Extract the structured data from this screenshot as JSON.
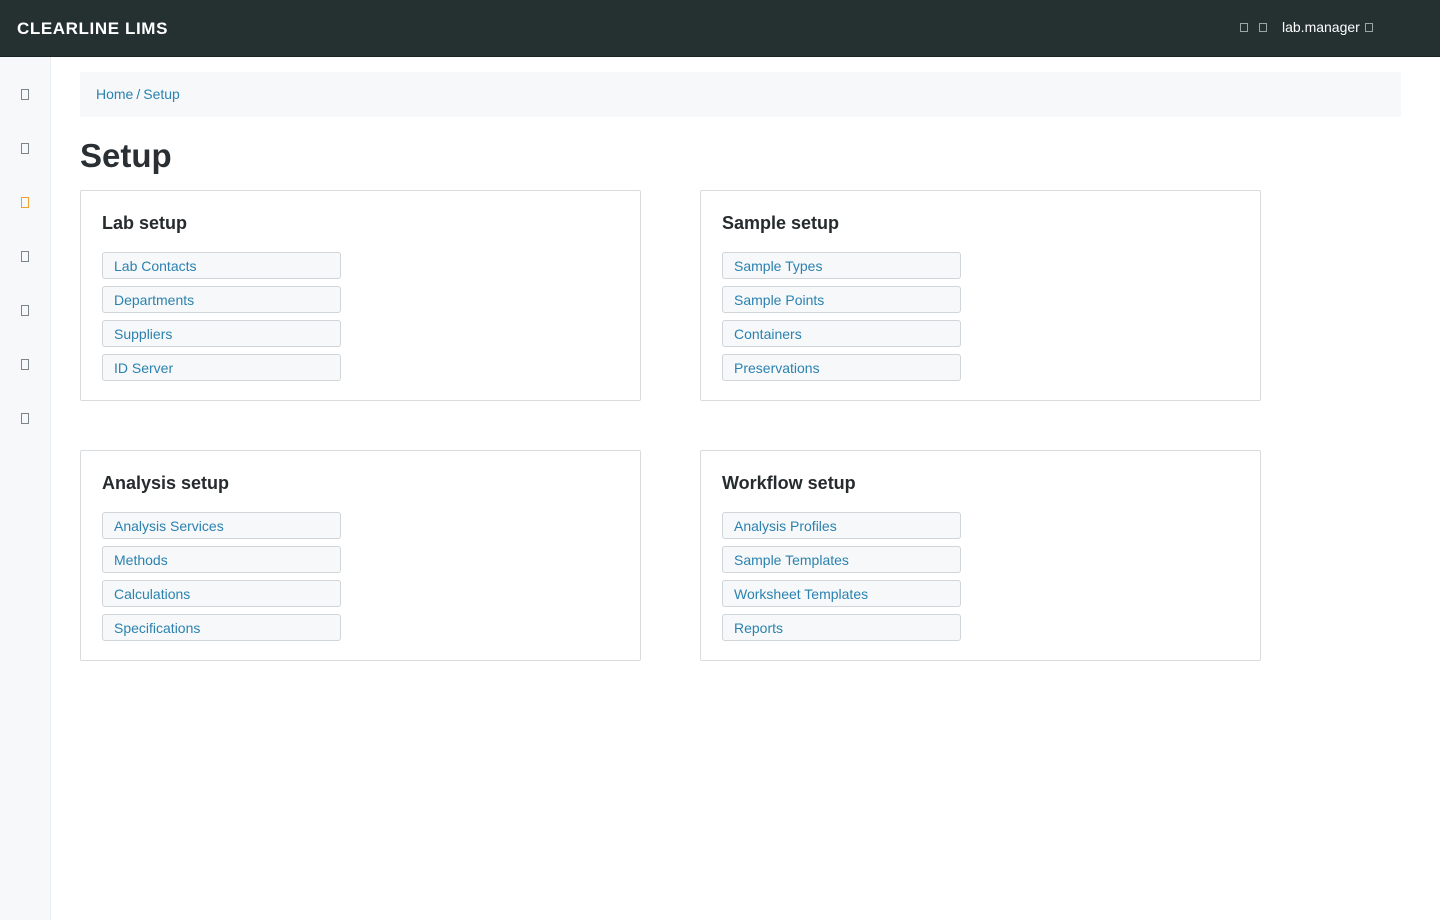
{
  "app": {
    "brand": "CLEARLINE LIMS"
  },
  "topbar": {
    "icons": [
      "notifications-icon",
      "help-icon"
    ],
    "user": "lab.manager",
    "user_icon": "chevron-down-icon"
  },
  "sidebar": {
    "items": [
      {
        "icon": "home-icon",
        "active": false
      },
      {
        "icon": "samples-icon",
        "active": false
      },
      {
        "icon": "setup-icon",
        "active": true
      },
      {
        "icon": "worksheets-icon",
        "active": false
      },
      {
        "icon": "clients-icon",
        "active": false
      },
      {
        "icon": "reports-icon",
        "active": false
      },
      {
        "icon": "settings-icon",
        "active": false
      }
    ],
    "active_color": "#f0a030"
  },
  "breadcrumb": {
    "home": "Home",
    "separator": "/",
    "current": "Setup"
  },
  "page": {
    "title": "Setup"
  },
  "panels": [
    {
      "title": "Lab setup",
      "links": [
        "Lab Contacts",
        "Departments",
        "Suppliers",
        "ID Server"
      ]
    },
    {
      "title": "Sample setup",
      "links": [
        "Sample Types",
        "Sample Points",
        "Containers",
        "Preservations"
      ]
    },
    {
      "title": "Analysis setup",
      "links": [
        "Analysis Services",
        "Methods",
        "Calculations",
        "Specifications"
      ]
    },
    {
      "title": "Workflow setup",
      "links": [
        "Analysis Profiles",
        "Sample Templates",
        "Worksheet Templates",
        "Reports"
      ]
    }
  ],
  "colors": {
    "topbar": "#253031",
    "link": "#2b82b0",
    "accent": "#f0a030"
  }
}
